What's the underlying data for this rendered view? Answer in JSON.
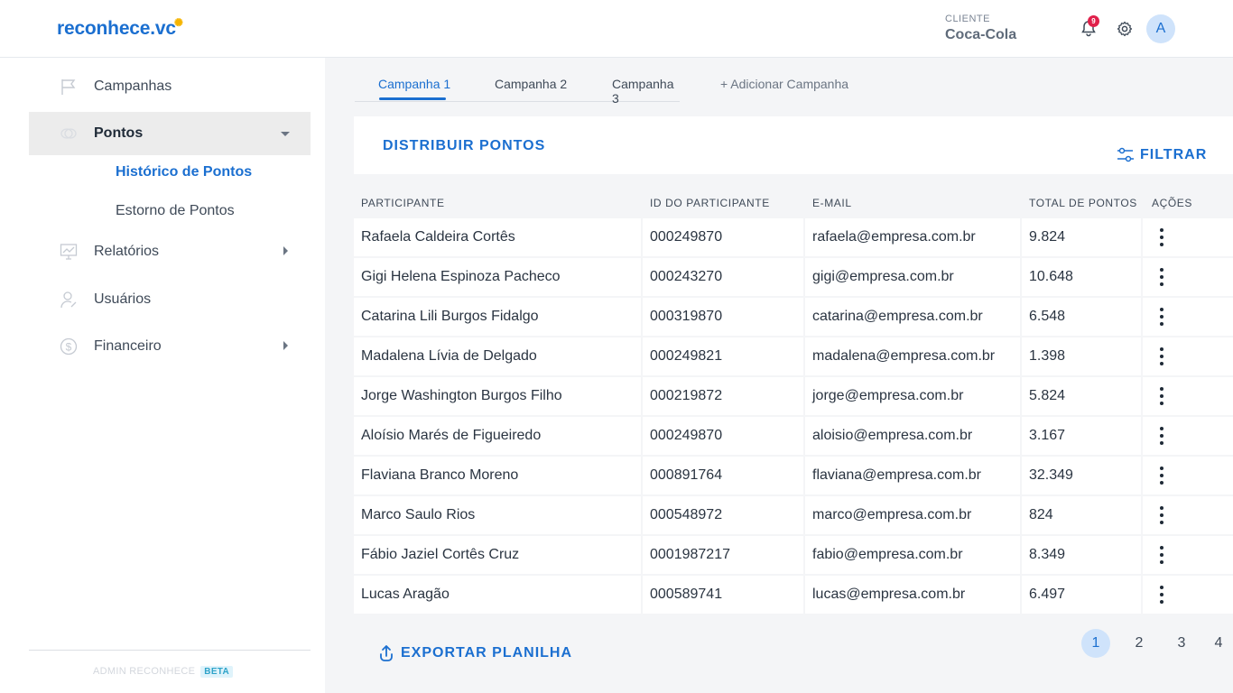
{
  "header": {
    "logo_text": "reconhece.vc",
    "client_label": "CLIENTE",
    "client_name": "Coca-Cola",
    "notification_count": "9",
    "avatar_initial": "A"
  },
  "sidebar": {
    "items": [
      {
        "label": "Campanhas",
        "icon": "flag-icon"
      },
      {
        "label": "Pontos",
        "icon": "coins-icon"
      },
      {
        "label": "Relatórios",
        "icon": "chart-icon"
      },
      {
        "label": "Usuários",
        "icon": "user-icon"
      },
      {
        "label": "Financeiro",
        "icon": "dollar-icon"
      }
    ],
    "subitems": [
      {
        "label": "Histórico de Pontos"
      },
      {
        "label": "Estorno de Pontos"
      }
    ],
    "footer_text": "ADMIN RECONHECE",
    "beta_label": "BETA"
  },
  "tabs": {
    "items": [
      {
        "label": "Campanha 1"
      },
      {
        "label": "Campanha 2"
      },
      {
        "label": "Campanha 3"
      }
    ],
    "add_label": "+ Adicionar Campanha"
  },
  "actions": {
    "distribuir_label": "DISTRIBUIR PONTOS",
    "filtrar_label": "FILTRAR",
    "export_label": "EXPORTAR PLANILHA"
  },
  "table": {
    "headers": [
      "PARTICIPANTE",
      "ID DO PARTICIPANTE",
      "E-MAIL",
      "TOTAL DE PONTOS",
      "AÇÕES"
    ],
    "rows": [
      [
        "Rafaela Caldeira Cortês",
        "000249870",
        "rafaela@empresa.com.br",
        "9.824"
      ],
      [
        "Gigi Helena Espinoza Pacheco",
        "000243270",
        "gigi@empresa.com.br",
        "10.648"
      ],
      [
        "Catarina Lili Burgos Fidalgo",
        "000319870",
        "catarina@empresa.com.br",
        "6.548"
      ],
      [
        "Madalena Lívia de Delgado",
        "000249821",
        "madalena@empresa.com.br",
        "1.398"
      ],
      [
        "Jorge Washington Burgos Filho",
        "000219872",
        "jorge@empresa.com.br",
        "5.824"
      ],
      [
        "Aloísio Marés de Figueiredo",
        "000249870",
        "aloisio@empresa.com.br",
        "3.167"
      ],
      [
        "Flaviana Branco Moreno",
        "000891764",
        "flaviana@empresa.com.br",
        "32.349"
      ],
      [
        "Marco Saulo Rios",
        "000548972",
        "marco@empresa.com.br",
        "824"
      ],
      [
        "Fábio Jaziel Cortês Cruz",
        "0001987217",
        "fabio@empresa.com.br",
        "8.349"
      ],
      [
        "Lucas Aragão",
        "000589741",
        "lucas@empresa.com.br",
        "6.497"
      ]
    ]
  },
  "pagination": {
    "pages": [
      "1",
      "2",
      "3",
      "4"
    ],
    "current": "1"
  },
  "colors": {
    "accent": "#1b6fd0",
    "badge": "#e0204b",
    "background": "#f4f5f7"
  }
}
